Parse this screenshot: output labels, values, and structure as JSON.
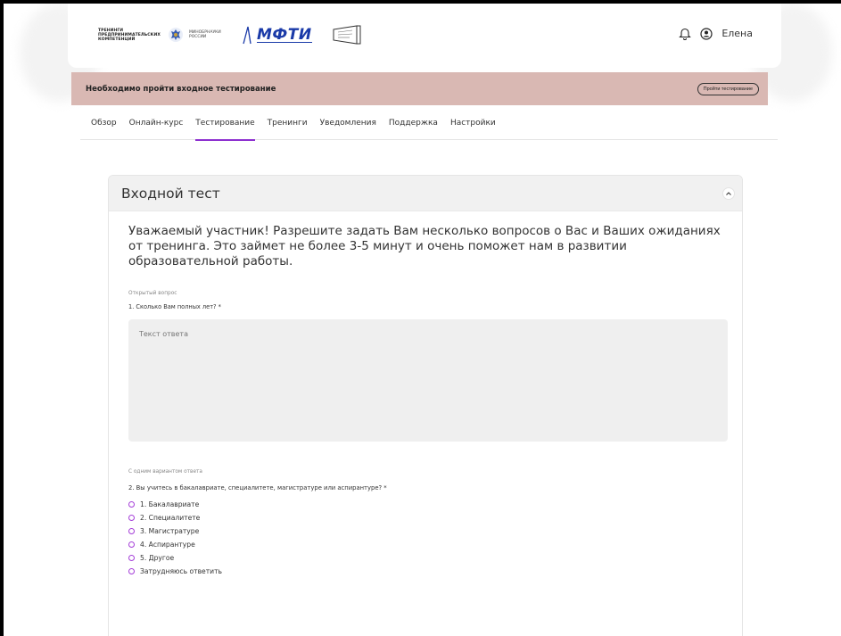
{
  "header": {
    "logo_trainings_lines": [
      "ТРЕНИНГИ",
      "ПРЕДПРИНИМАТЕЛЬСКИХ",
      "КОМПЕТЕНЦИЙ"
    ],
    "logo_minobr_lines": [
      "МИНОБРНАУКИ",
      "РОССИИ"
    ],
    "logo_mfti": "МФТИ",
    "user_name": "Елена"
  },
  "banner": {
    "text": "Необходимо пройти входное тестирование",
    "button_label": "Пройти тестирование"
  },
  "tabs": [
    {
      "label": "Обзор",
      "active": false
    },
    {
      "label": "Онлайн-курс",
      "active": false
    },
    {
      "label": "Тестирование",
      "active": true
    },
    {
      "label": "Тренинги",
      "active": false
    },
    {
      "label": "Уведомления",
      "active": false
    },
    {
      "label": "Поддержка",
      "active": false
    },
    {
      "label": "Настройки",
      "active": false
    }
  ],
  "test": {
    "title": "Входной тест",
    "intro": "Уважаемый участник! Разрешите задать Вам несколько вопросов о Вас и Ваших ожиданиях от тренинга. Это займет не более 3-5 минут и очень поможет нам в развитии образовательной работы.",
    "q1": {
      "type": "Открытый вопрос",
      "text": "1. Сколько Вам полных лет? *",
      "placeholder": "Текст ответа"
    },
    "q2": {
      "type": "С одним вариантом ответа",
      "text": "2. Вы учитесь в бакалавриате, специалитете, магистратуре или аспирантуре? *",
      "options": [
        "1. Бакалавриате",
        "2. Специалитете",
        "3. Магистратуре",
        "4. Аспирантуре",
        "5. Другое",
        "Затрудняюсь ответить"
      ]
    }
  },
  "colors": {
    "accent": "#8d2fd0",
    "banner_bg": "#d9b8b3",
    "mfti_blue": "#1a3aa8"
  }
}
